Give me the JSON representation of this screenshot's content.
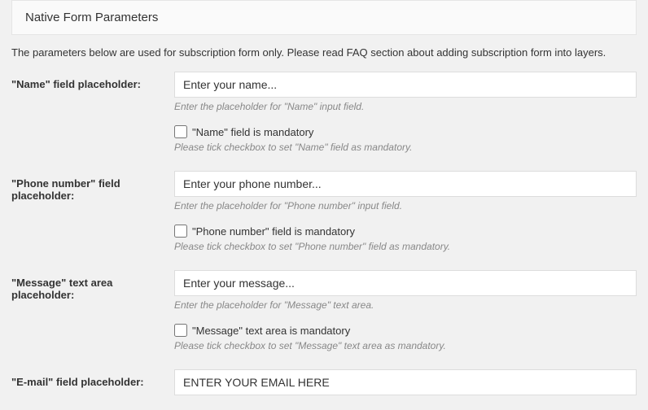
{
  "header": {
    "title": "Native Form Parameters"
  },
  "description": "The parameters below are used for subscription form only. Please read FAQ section about adding subscription form into layers.",
  "fields": {
    "name": {
      "label": "\"Name\" field placeholder:",
      "value": "Enter your name...",
      "hint": "Enter the placeholder for \"Name\" input field.",
      "checkbox_label": "\"Name\" field is mandatory",
      "checkbox_hint": "Please tick checkbox to set \"Name\" field as mandatory."
    },
    "phone": {
      "label": "\"Phone number\" field placeholder:",
      "value": "Enter your phone number...",
      "hint": "Enter the placeholder for \"Phone number\" input field.",
      "checkbox_label": "\"Phone number\" field is mandatory",
      "checkbox_hint": "Please tick checkbox to set \"Phone number\" field as mandatory."
    },
    "message": {
      "label": "\"Message\" text area placeholder:",
      "value": "Enter your message...",
      "hint": "Enter the placeholder for \"Message\" text area.",
      "checkbox_label": "\"Message\" text area is mandatory",
      "checkbox_hint": "Please tick checkbox to set \"Message\" text area as mandatory."
    },
    "email": {
      "label": "\"E-mail\" field placeholder:",
      "value": "ENTER YOUR EMAIL HERE"
    }
  }
}
